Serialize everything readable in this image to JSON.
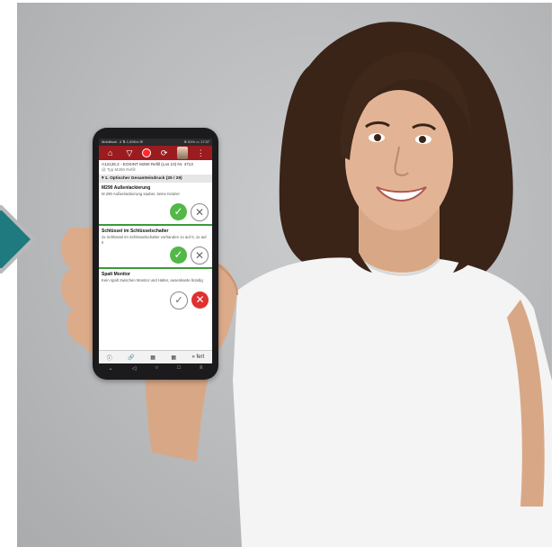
{
  "colors": {
    "accent_arrow": "#1e7a7e",
    "toolbar": "#9b1c1f",
    "ok_green": "#52b848",
    "no_red": "#e03030"
  },
  "phone": {
    "status_left": "Mobilfunk ..il ⇅ 1,59K/s ✉",
    "status_right": "⊕ 51% ▭ 17:37",
    "toolbar_icons": [
      "home-icon",
      "filter-icon",
      "record-icon",
      "sync-icon",
      "avatar",
      "more-icon"
    ],
    "info_line1": "A12126.2 - EOSINT M290 Refill (Los 10) Nr. 4713",
    "info_line2": "@ Typ M290 Refill",
    "group_title": "▾ 1. Optischer Gesamteindruck (25 / 29)",
    "items": [
      {
        "title": "M290 Außenlackierung",
        "desc": "M 290 Außenlackierung sauber, keine Kratzer"
      },
      {
        "title": "Schlüssel im Schlüsselschalter",
        "desc": "2x Schlüssel im Schlüsselschalter vorhanden 1x auf 0, 1x auf II"
      },
      {
        "title": "Spalt Monitor",
        "desc": "Kein spalt zwischen Monitor und Halter, ausenkante bündig"
      }
    ],
    "bottom_items": [
      "ⓘ",
      "🔗",
      "▦",
      "▦",
      "» fert"
    ]
  }
}
